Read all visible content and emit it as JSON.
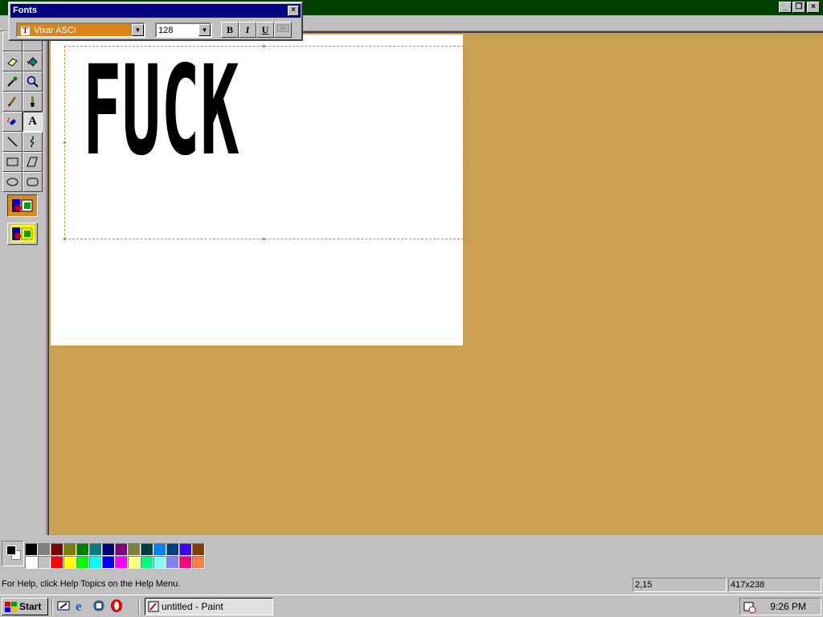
{
  "fonts_toolbar": {
    "title": "Fonts",
    "close_glyph": "×",
    "font_name": "Vixar ASCI",
    "font_size": "128",
    "bold_label": "B",
    "italic_label": "I",
    "underline_label": "U"
  },
  "canvas": {
    "text": "FUCK"
  },
  "palette": {
    "row1": [
      "#000000",
      "#808080",
      "#800000",
      "#808000",
      "#008000",
      "#008080",
      "#000080",
      "#800080",
      "#808040",
      "#004040",
      "#0080ff",
      "#004080",
      "#4000ff",
      "#804000"
    ],
    "row2": [
      "#ffffff",
      "#c0c0c0",
      "#ff0000",
      "#ffff00",
      "#00ff00",
      "#00ffff",
      "#0000ff",
      "#ff00ff",
      "#ffff80",
      "#00ff80",
      "#80ffff",
      "#8080ff",
      "#ff0080",
      "#ff8040"
    ],
    "foreground": "#000000",
    "background": "#ffffff"
  },
  "statusbar": {
    "help": "For Help, click Help Topics on the Help Menu.",
    "coords": "2,15",
    "size": "417x238"
  },
  "taskbar": {
    "start_label": "Start",
    "task_label": "untitled - Paint",
    "clock": "9:26 PM"
  },
  "colors": {
    "titlebar": "#004000",
    "workspace": "#c9a052",
    "selection_highlight": "#d8861c"
  }
}
